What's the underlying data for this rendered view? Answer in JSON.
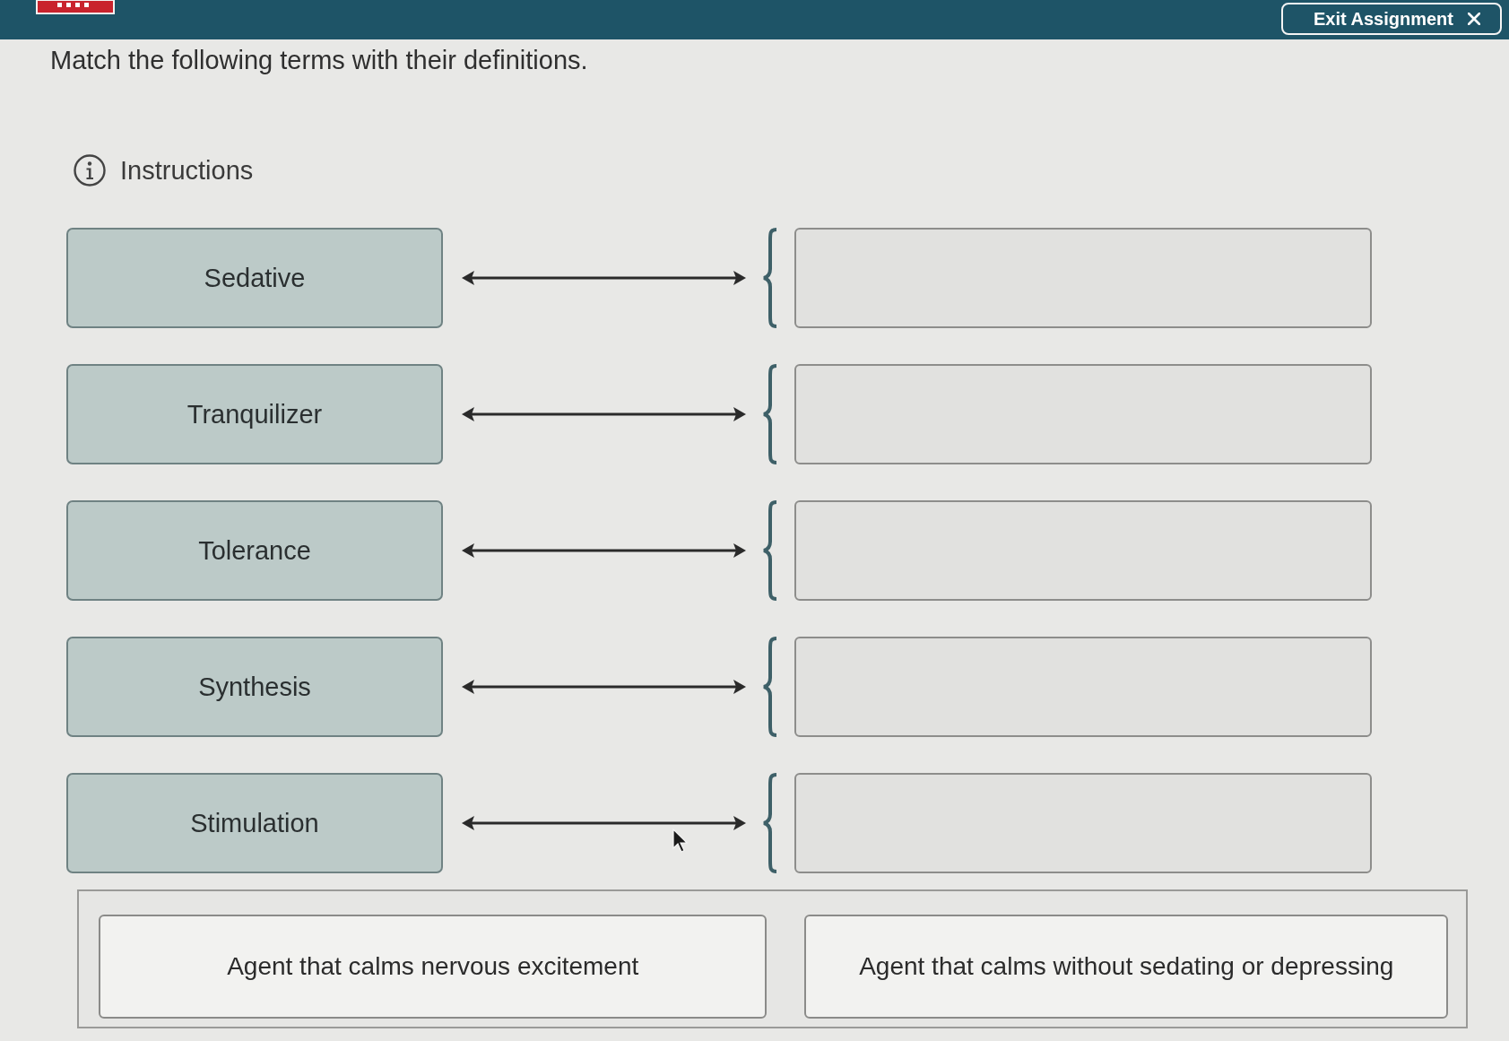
{
  "header": {
    "exit_button": "Exit Assignment"
  },
  "prompt": "Match the following terms with their definitions.",
  "instructions": "Instructions",
  "pairs": [
    {
      "term": "Sedative"
    },
    {
      "term": "Tranquilizer"
    },
    {
      "term": "Tolerance"
    },
    {
      "term": "Synthesis"
    },
    {
      "term": "Stimulation"
    }
  ],
  "choices": [
    "Agent that calms nervous excitement",
    "Agent that calms without sedating or depressing"
  ]
}
